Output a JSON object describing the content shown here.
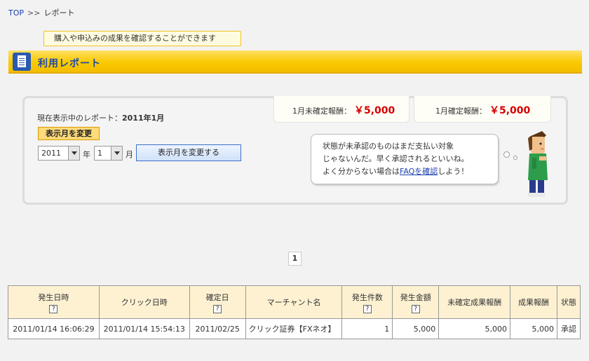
{
  "breadcrumb": {
    "home": "TOP",
    "separator": ">>",
    "current": "レポート"
  },
  "tip": "購入や申込みの成果を確認することができます",
  "page_title": "利用レポート",
  "current_report": {
    "label": "現在表示中のレポート：",
    "value": "2011年1月"
  },
  "change_month_label": "表示月を変更",
  "year_select": {
    "value": "2011",
    "suffix": "年"
  },
  "month_select": {
    "value": "1",
    "suffix": "月"
  },
  "submit_label": "表示月を変更する",
  "unconfirmed_reward": {
    "label": "1月未確定報酬：",
    "amount": "￥5,000"
  },
  "confirmed_reward": {
    "label": "1月確定報酬：",
    "amount": "￥5,000"
  },
  "bubble": {
    "line1": "状態が未承認のものはまだ支払い対象",
    "line2": "じゃないんだ。早く承認されるといいね。",
    "line3_pre": "よく分からない場合は",
    "line3_link": "FAQを確認",
    "line3_post": "しよう！"
  },
  "pagination": {
    "current": "1"
  },
  "table": {
    "help_icon": "?",
    "headers": [
      "発生日時",
      "クリック日時",
      "確定日",
      "マーチャント名",
      "発生件数",
      "発生金額",
      "未確定成果報酬",
      "成果報酬",
      "状態"
    ],
    "rows": [
      [
        "2011/01/14 16:06:29",
        "2011/01/14 15:54:13",
        "2011/02/25",
        "クリック証券【FXネオ】",
        "1",
        "5,000",
        "5,000",
        "5,000",
        "承認"
      ]
    ]
  },
  "colors": {
    "accent": "#f9c900",
    "link": "#1a3fb0",
    "amount": "#d40000",
    "title": "#1f4aa8"
  }
}
